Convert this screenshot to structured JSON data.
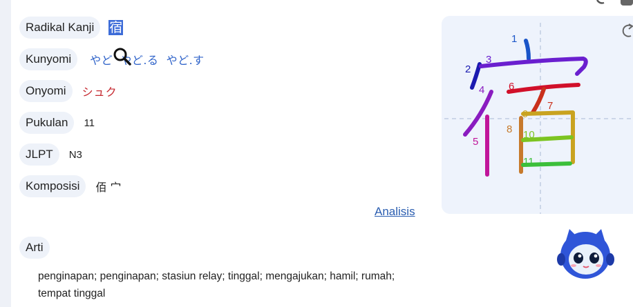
{
  "fields": {
    "radical": {
      "label": "Radikal Kanji",
      "value": "宿"
    },
    "kunyomi": {
      "label": "Kunyomi",
      "value": "やど  やど.る  やど.す"
    },
    "onyomi": {
      "label": "Onyomi",
      "value": "シュク"
    },
    "strokes": {
      "label": "Pukulan",
      "value": "11"
    },
    "jlpt": {
      "label": "JLPT",
      "value": "N3"
    },
    "components": {
      "label": "Komposisi",
      "value": "佰 宀"
    }
  },
  "analysis_link": "Analisis",
  "meaning": {
    "label": "Arti",
    "text": "penginapan; penginapan; stasiun relay; tinggal; mengajukan; hamil; rumah; tempat tinggal"
  },
  "stroke_diagram": {
    "numbers": [
      "1",
      "2",
      "3",
      "4",
      "5",
      "6",
      "7",
      "8",
      "9",
      "10",
      "11"
    ],
    "colors": {
      "s1": "#1a55c8",
      "s2": "#1b1bb0",
      "s3": "#6a1fcf",
      "s4": "#8a1cc0",
      "s5": "#c0159a",
      "s6": "#d1102a",
      "s7": "#c9301c",
      "s8": "#c77a2c",
      "s9": "#c9a320",
      "s10": "#7cc421",
      "s11": "#3cbf3a"
    }
  },
  "icons": {
    "magnifier": "magnifier-cursor-icon",
    "refresh": "refresh-icon",
    "mascot": "robot-mascot-icon"
  }
}
